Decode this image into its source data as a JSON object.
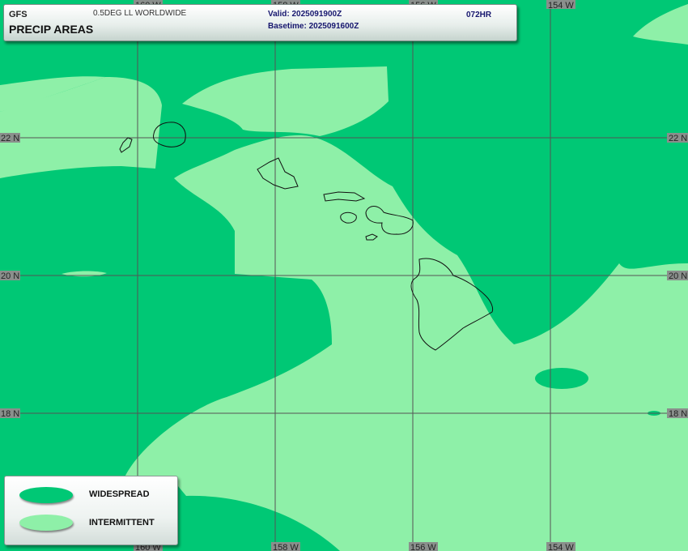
{
  "header": {
    "model": "GFS",
    "grid": "0.5DEG LL WORLDWIDE",
    "product": "PRECIP AREAS",
    "valid": "Valid: 2025091900Z",
    "basetime": "Basetime: 2025091600Z",
    "forecast_hour": "072HR"
  },
  "map": {
    "lon_labels": [
      "160 W",
      "158 W",
      "156 W",
      "154 W"
    ],
    "lat_labels": [
      "22 N",
      "20 N",
      "18 N"
    ],
    "colors": {
      "widespread": "#00c875",
      "intermittent": "#8ef0a8",
      "grid": "#555555",
      "coast": "#111111"
    }
  },
  "legend": {
    "items": [
      {
        "label": "WIDESPREAD",
        "color": "#00c875"
      },
      {
        "label": "INTERMITTENT",
        "color": "#8ef0a8"
      }
    ]
  }
}
